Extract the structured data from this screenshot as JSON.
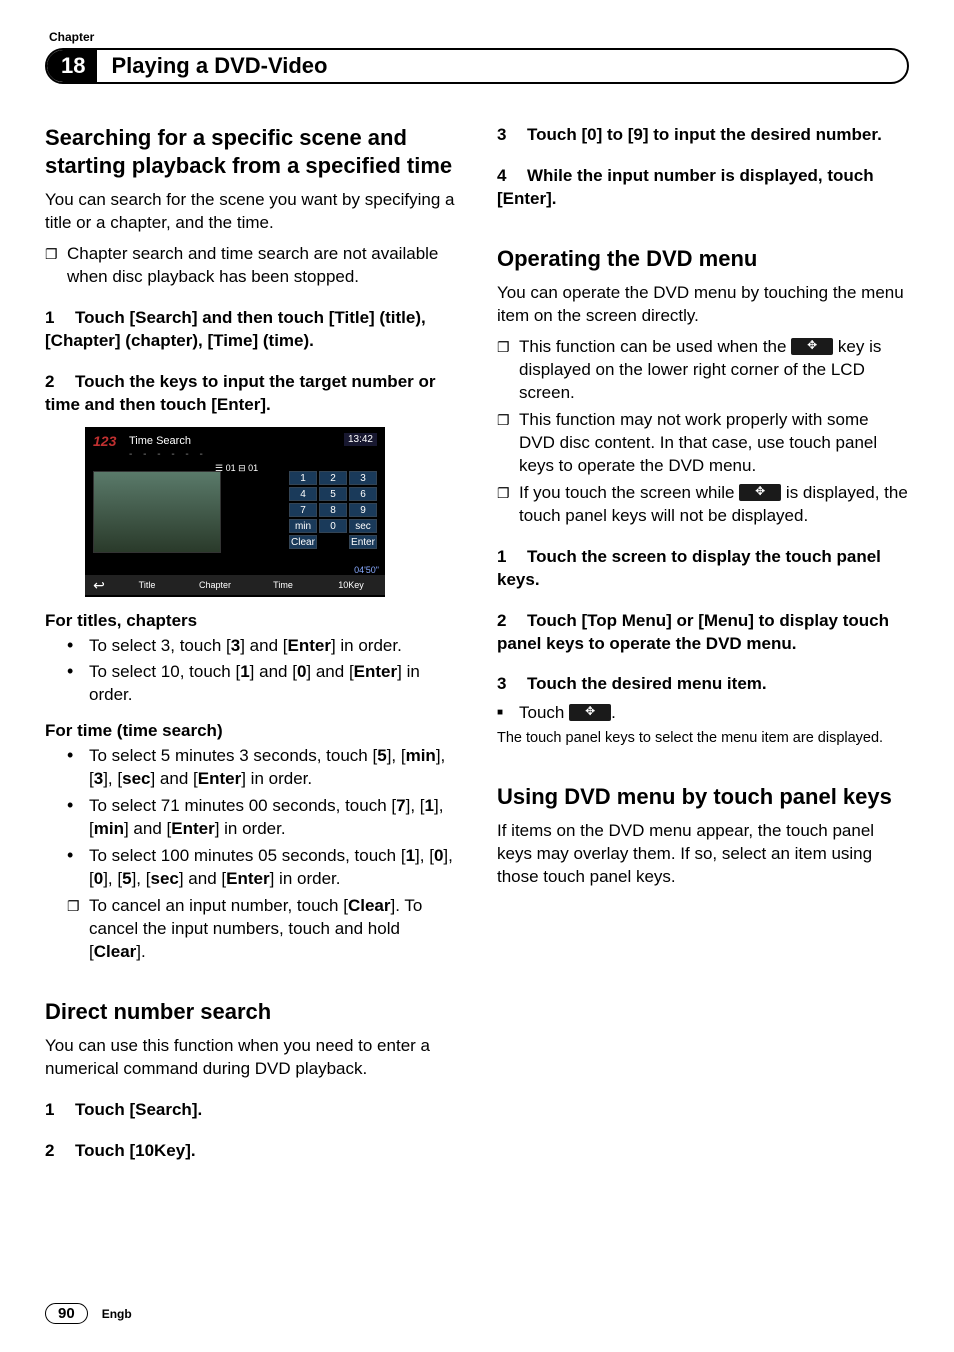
{
  "header": {
    "chapter_label": "Chapter",
    "chapter_number": "18",
    "title": "Playing a DVD-Video"
  },
  "left": {
    "s1": {
      "heading": "Searching for a specific scene and starting playback from a specified time",
      "intro": "You can search for the scene you want by specifying a title or a chapter, and the time.",
      "note1": "Chapter search and time search are not available when disc playback has been stopped.",
      "step1_pre": "1",
      "step1": "Touch [Search] and then touch [Title] (title), [Chapter] (chapter), [Time] (time).",
      "step2_pre": "2",
      "step2": "Touch the keys to input the target number or time and then touch [Enter].",
      "screenshot": {
        "corner": "123",
        "title": "Time Search",
        "clock": "13:42",
        "dashes": "- - - - - -",
        "info1": "☰ 01    ⊟ 01",
        "keypad": [
          "1",
          "2",
          "3",
          "4",
          "5",
          "6",
          "7",
          "8",
          "9",
          "min",
          "0",
          "sec",
          "Clear",
          "",
          "Enter"
        ],
        "bottom": [
          "↩",
          "Title",
          "Chapter",
          "Time",
          "10Key"
        ],
        "timer": "04'50\""
      },
      "sub1": "For titles, chapters",
      "b1": "To select 3, touch [<b>3</b>] and [<b>Enter</b>] in order.",
      "b2": "To select 10, touch [<b>1</b>] and [<b>0</b>] and [<b>Enter</b>] in order.",
      "sub2": "For time (time search)",
      "b3": "To select 5 minutes 3 seconds, touch [<b>5</b>], [<b>min</b>], [<b>3</b>], [<b>sec</b>] and [<b>Enter</b>] in order.",
      "b4": "To select 71 minutes 00 seconds, touch [<b>7</b>], [<b>1</b>], [<b>min</b>] and [<b>Enter</b>] in order.",
      "b5": "To select 100 minutes 05 seconds, touch [<b>1</b>], [<b>0</b>], [<b>0</b>], [<b>5</b>], [<b>sec</b>] and [<b>Enter</b>] in order.",
      "b6": "To cancel an input number, touch [<b>Clear</b>]. To cancel the input numbers, touch and hold [<b>Clear</b>]."
    },
    "s2": {
      "heading": "Direct number search",
      "intro": "You can use this function when you need to enter a numerical command during DVD playback.",
      "step1_pre": "1",
      "step1": "Touch [Search].",
      "step2_pre": "2",
      "step2": "Touch [10Key]."
    }
  },
  "right": {
    "r1": {
      "pre": "3",
      "text": "Touch [0] to [9] to input the desired number."
    },
    "r2": {
      "pre": "4",
      "text": "While the input number is displayed, touch [Enter]."
    },
    "s3": {
      "heading": "Operating the DVD menu",
      "intro": "You can operate the DVD menu by touching the menu item on the screen directly.",
      "n1a": "This function can be used when the ",
      "n1b": " key is displayed on the lower right corner of the LCD screen.",
      "n2": "This function may not work properly with some DVD disc content. In that case, use touch panel keys to operate the DVD menu.",
      "n3a": "If you touch the screen while ",
      "n3b": " is displayed, the touch panel keys will not be displayed.",
      "st1_pre": "1",
      "st1": "Touch the screen to display the touch panel keys.",
      "st2_pre": "2",
      "st2": "Touch [Top Menu] or [Menu] to display touch panel keys to operate the DVD menu.",
      "st3_pre": "3",
      "st3": "Touch the desired menu item.",
      "tip_a": "Touch ",
      "tip_b": ".",
      "note": "The touch panel keys to select the menu item are displayed."
    },
    "s4": {
      "heading": "Using DVD menu by touch panel keys",
      "intro": "If items on the DVD menu appear, the touch panel keys may overlay them. If so, select an item using those touch panel keys."
    }
  },
  "footer": {
    "page": "90",
    "lang": "Engb"
  }
}
